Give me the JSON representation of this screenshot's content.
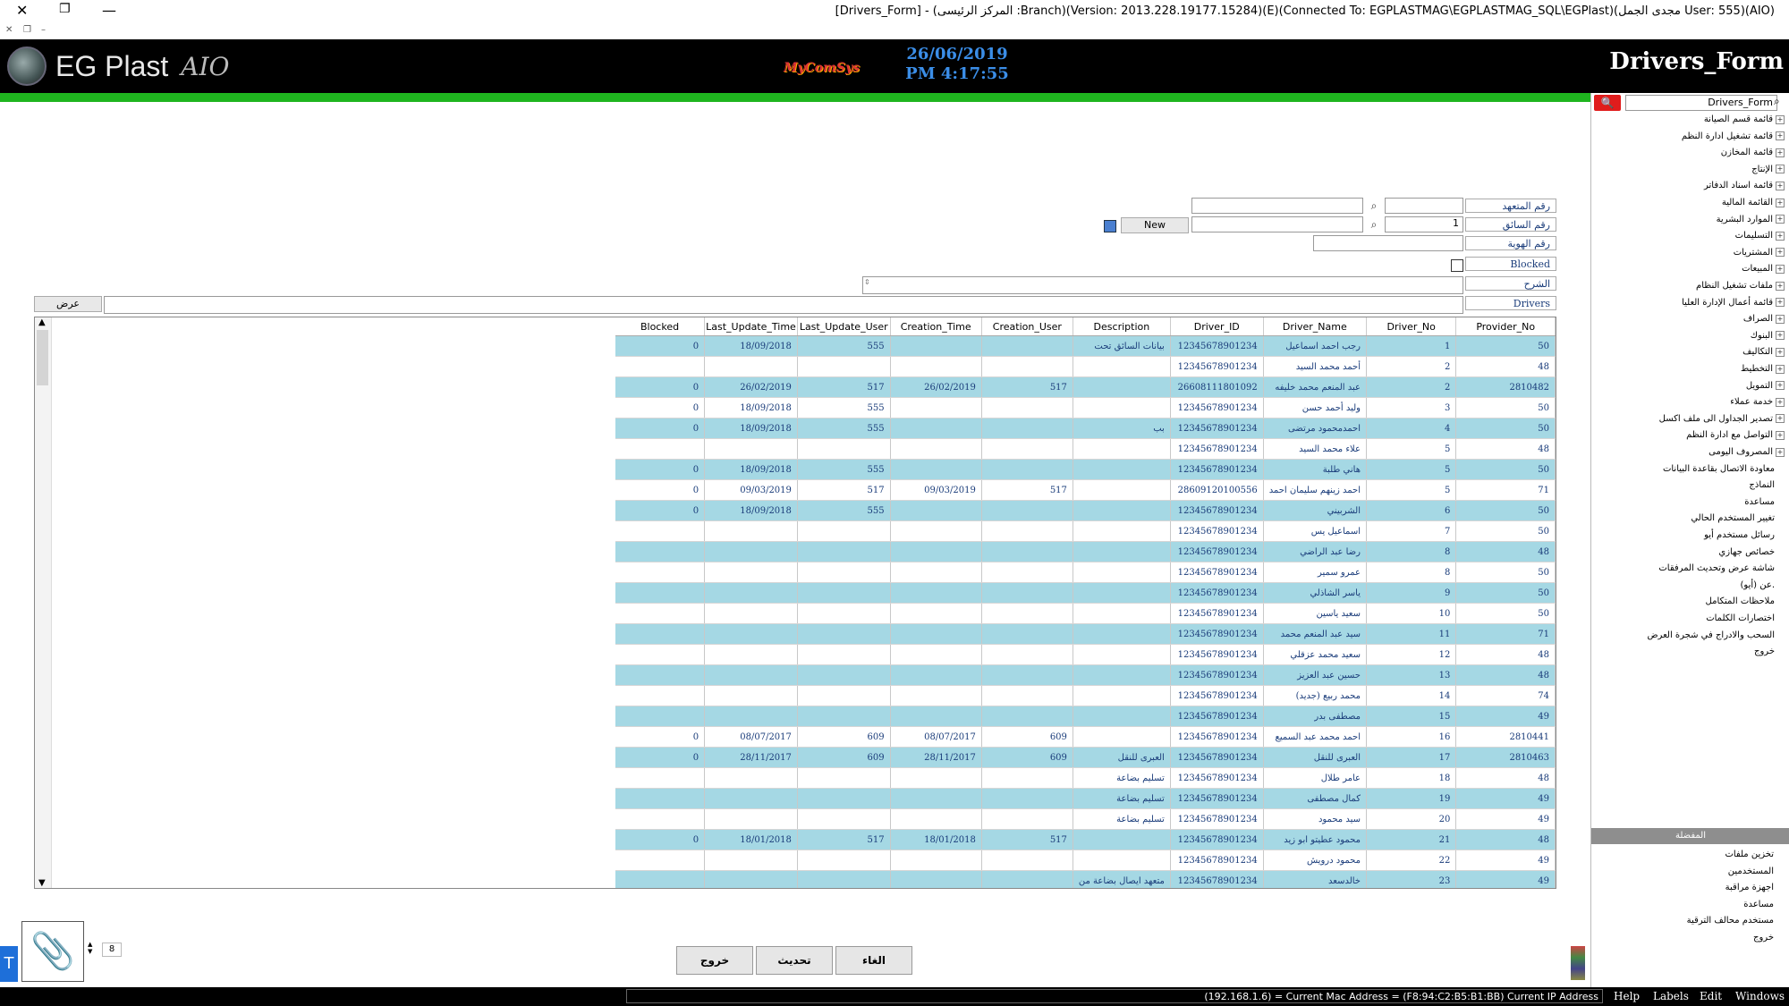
{
  "window": {
    "title": "[Drivers_Form] - (المركز الرئيسى :Branch)(Version: 2013.228.19177.15284)(E)(Connected To: EGPLASTMAG\\EGPLASTMAG_SQL\\EGPlast)(مجدى الجمل User: 555)(AIO)"
  },
  "header": {
    "logo_text": "EG Plast",
    "logo_suffix": "AIO",
    "brand": "MyComSys",
    "date": "26/06/2019",
    "time": "PM 4:17:55",
    "form_title": "Drivers_Form"
  },
  "form": {
    "labels": {
      "contractor_no": "رقم المتعهد",
      "driver_no": "رقم السائق",
      "id_no": "رقم الهوية",
      "blocked": "Blocked",
      "description": "الشرح",
      "drivers": "Drivers"
    },
    "driver_no_value": "1",
    "new_button": "New",
    "show_button": "عرض"
  },
  "grid": {
    "columns": [
      "Blocked",
      "Last_Update_Time",
      "Last_Update_User",
      "Creation_Time",
      "Creation_User",
      "Description",
      "Driver_ID",
      "Driver_Name",
      "Driver_No",
      "Provider_No"
    ],
    "rows": [
      {
        "blocked": "0",
        "lut": "18/09/2018",
        "luu": "555",
        "ct": "",
        "cu": "",
        "desc": "بيانات السائق تحت",
        "id": "12345678901234",
        "name": "رجب احمد اسماعيل",
        "no": "1",
        "prov": "50"
      },
      {
        "blocked": "",
        "lut": "",
        "luu": "",
        "ct": "",
        "cu": "",
        "desc": "",
        "id": "12345678901234",
        "name": "أحمد محمد السيد",
        "no": "2",
        "prov": "48"
      },
      {
        "blocked": "0",
        "lut": "26/02/2019",
        "luu": "517",
        "ct": "26/02/2019",
        "cu": "517",
        "desc": "",
        "id": "26608111801092",
        "name": "عبد المنعم محمد خليفه",
        "no": "2",
        "prov": "2810482"
      },
      {
        "blocked": "0",
        "lut": "18/09/2018",
        "luu": "555",
        "ct": "",
        "cu": "",
        "desc": "",
        "id": "12345678901234",
        "name": "وليد أحمد حسن",
        "no": "3",
        "prov": "50"
      },
      {
        "blocked": "0",
        "lut": "18/09/2018",
        "luu": "555",
        "ct": "",
        "cu": "",
        "desc": "بب",
        "id": "12345678901234",
        "name": "احمدمحمود مرتضى",
        "no": "4",
        "prov": "50"
      },
      {
        "blocked": "",
        "lut": "",
        "luu": "",
        "ct": "",
        "cu": "",
        "desc": "",
        "id": "12345678901234",
        "name": "علاء محمد السيد",
        "no": "5",
        "prov": "48"
      },
      {
        "blocked": "0",
        "lut": "18/09/2018",
        "luu": "555",
        "ct": "",
        "cu": "",
        "desc": "",
        "id": "12345678901234",
        "name": "هاني طلبة",
        "no": "5",
        "prov": "50"
      },
      {
        "blocked": "0",
        "lut": "09/03/2019",
        "luu": "517",
        "ct": "09/03/2019",
        "cu": "517",
        "desc": "",
        "id": "28609120100556",
        "name": "احمد زينهم سليمان احمد",
        "no": "5",
        "prov": "71"
      },
      {
        "blocked": "0",
        "lut": "18/09/2018",
        "luu": "555",
        "ct": "",
        "cu": "",
        "desc": "",
        "id": "12345678901234",
        "name": "الشربيني",
        "no": "6",
        "prov": "50"
      },
      {
        "blocked": "",
        "lut": "",
        "luu": "",
        "ct": "",
        "cu": "",
        "desc": "",
        "id": "12345678901234",
        "name": "اسماعيل يس",
        "no": "7",
        "prov": "50"
      },
      {
        "blocked": "",
        "lut": "",
        "luu": "",
        "ct": "",
        "cu": "",
        "desc": "",
        "id": "12345678901234",
        "name": "رضا عبد الراضي",
        "no": "8",
        "prov": "48"
      },
      {
        "blocked": "",
        "lut": "",
        "luu": "",
        "ct": "",
        "cu": "",
        "desc": "",
        "id": "12345678901234",
        "name": "عمرو سمير",
        "no": "8",
        "prov": "50"
      },
      {
        "blocked": "",
        "lut": "",
        "luu": "",
        "ct": "",
        "cu": "",
        "desc": "",
        "id": "12345678901234",
        "name": "ياسر الشاذلي",
        "no": "9",
        "prov": "50"
      },
      {
        "blocked": "",
        "lut": "",
        "luu": "",
        "ct": "",
        "cu": "",
        "desc": "",
        "id": "12345678901234",
        "name": "سعيد ياسين",
        "no": "10",
        "prov": "50"
      },
      {
        "blocked": "",
        "lut": "",
        "luu": "",
        "ct": "",
        "cu": "",
        "desc": "",
        "id": "12345678901234",
        "name": "سيد عبد المنعم محمد",
        "no": "11",
        "prov": "71"
      },
      {
        "blocked": "",
        "lut": "",
        "luu": "",
        "ct": "",
        "cu": "",
        "desc": "",
        "id": "12345678901234",
        "name": "سعيد محمد عزقلي",
        "no": "12",
        "prov": "48"
      },
      {
        "blocked": "",
        "lut": "",
        "luu": "",
        "ct": "",
        "cu": "",
        "desc": "",
        "id": "12345678901234",
        "name": "حسين عبد العزيز",
        "no": "13",
        "prov": "48"
      },
      {
        "blocked": "",
        "lut": "",
        "luu": "",
        "ct": "",
        "cu": "",
        "desc": "",
        "id": "12345678901234",
        "name": "محمد ربيع (جديد)",
        "no": "14",
        "prov": "74"
      },
      {
        "blocked": "",
        "lut": "",
        "luu": "",
        "ct": "",
        "cu": "",
        "desc": "",
        "id": "12345678901234",
        "name": "مصطفى بدر",
        "no": "15",
        "prov": "49"
      },
      {
        "blocked": "0",
        "lut": "08/07/2017",
        "luu": "609",
        "ct": "08/07/2017",
        "cu": "609",
        "desc": "",
        "id": "12345678901234",
        "name": "احمد محمد عبد السميع",
        "no": "16",
        "prov": "2810441"
      },
      {
        "blocked": "0",
        "lut": "28/11/2017",
        "luu": "609",
        "ct": "28/11/2017",
        "cu": "609",
        "desc": "العبرى للنقل",
        "id": "12345678901234",
        "name": "العبرى للنقل",
        "no": "17",
        "prov": "2810463"
      },
      {
        "blocked": "",
        "lut": "",
        "luu": "",
        "ct": "",
        "cu": "",
        "desc": "تسليم بضاعة",
        "id": "12345678901234",
        "name": "عامر طلال",
        "no": "18",
        "prov": "48"
      },
      {
        "blocked": "",
        "lut": "",
        "luu": "",
        "ct": "",
        "cu": "",
        "desc": "تسليم بضاعة",
        "id": "12345678901234",
        "name": "كمال مصطفى",
        "no": "19",
        "prov": "49"
      },
      {
        "blocked": "",
        "lut": "",
        "luu": "",
        "ct": "",
        "cu": "",
        "desc": "تسليم بضاعة",
        "id": "12345678901234",
        "name": "سيد محمود",
        "no": "20",
        "prov": "49"
      },
      {
        "blocked": "0",
        "lut": "18/01/2018",
        "luu": "517",
        "ct": "18/01/2018",
        "cu": "517",
        "desc": "",
        "id": "12345678901234",
        "name": "محمود عطيتو ابو زيد",
        "no": "21",
        "prov": "48"
      },
      {
        "blocked": "",
        "lut": "",
        "luu": "",
        "ct": "",
        "cu": "",
        "desc": "",
        "id": "12345678901234",
        "name": "محمود درويش",
        "no": "22",
        "prov": "49"
      },
      {
        "blocked": "",
        "lut": "",
        "luu": "",
        "ct": "",
        "cu": "",
        "desc": "متعهد ايصال بضاعة من",
        "id": "12345678901234",
        "name": "خالدسعد",
        "no": "23",
        "prov": "49"
      }
    ]
  },
  "tree": {
    "search_value": "Drivers_Form",
    "items": [
      {
        "label": "قائمة قسم الصيانة",
        "expand": true
      },
      {
        "label": "قائمة تشغيل ادارة النظم",
        "expand": true
      },
      {
        "label": "قائمة المخازن",
        "expand": true
      },
      {
        "label": "الإنتاج",
        "expand": true
      },
      {
        "label": "قائمة اسناد الدفاتر",
        "expand": true
      },
      {
        "label": "القائمة المالية",
        "expand": true
      },
      {
        "label": "الموارد البشرية",
        "expand": true
      },
      {
        "label": "التسليمات",
        "expand": true
      },
      {
        "label": "المشتريات",
        "expand": true
      },
      {
        "label": "المبيعات",
        "expand": true
      },
      {
        "label": "ملفات تشغيل النظام",
        "expand": true
      },
      {
        "label": "قائمة أعمال الإدارة العليا",
        "expand": true
      },
      {
        "label": "الصراف",
        "expand": true
      },
      {
        "label": "البنوك",
        "expand": true
      },
      {
        "label": "التكاليف",
        "expand": true
      },
      {
        "label": "التخطيط",
        "expand": true
      },
      {
        "label": "التمويل",
        "expand": true
      },
      {
        "label": "خدمة عملاء",
        "expand": true
      },
      {
        "label": "تصدير الجداول الى ملف اكسل",
        "expand": true
      },
      {
        "label": "التواصل مع ادارة النظم",
        "expand": true
      },
      {
        "label": "المصروف اليومى",
        "expand": true
      },
      {
        "label": "معاودة الاتصال بقاعدة البيانات",
        "expand": false
      },
      {
        "label": "النماذج",
        "expand": false
      },
      {
        "label": "مساعدة",
        "expand": false
      },
      {
        "label": "تغيير المستخدم الحالي",
        "expand": false
      },
      {
        "label": "رسائل مستخدم أيو",
        "expand": false
      },
      {
        "label": "خصائص جهازي",
        "expand": false
      },
      {
        "label": "شاشة عرض وتحديث المرفقات",
        "expand": false
      },
      {
        "label": "عن (أيو).",
        "expand": false
      },
      {
        "label": "ملاحظات المتكامل",
        "expand": false
      },
      {
        "label": "اختصارات الكلمات",
        "expand": false
      },
      {
        "label": "السحب والادراج في شجرة العرض",
        "expand": false
      },
      {
        "label": "خروج",
        "expand": false
      }
    ],
    "favorites_header": "المفضلة",
    "favorites": [
      "تخزين ملفات",
      "المستخدمين",
      "اجهزة مراقبة",
      "مساعدة",
      "مستخدم محالف الترقية",
      "خروج"
    ]
  },
  "bottom": {
    "spinner_value": "8",
    "buttons": {
      "exit": "خروج",
      "refresh": "تحديث",
      "cancel": "الغاء"
    }
  },
  "status": {
    "ip_text": "(192.168.1.6) = Current Mac Address = (F8:94:C2:B5:B1:BB) Current IP Address",
    "menu": [
      "Help",
      "Labels",
      "Edit",
      "Windows"
    ]
  }
}
